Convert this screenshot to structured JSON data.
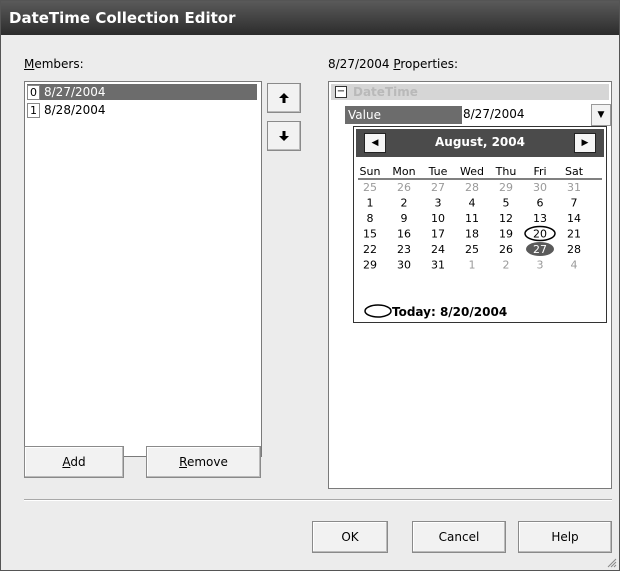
{
  "window": {
    "title": "DateTime Collection Editor"
  },
  "members": {
    "label_prefix": "",
    "label_accel": "M",
    "label_rest": "embers:",
    "items": [
      {
        "index": "0",
        "value": "8/27/2004",
        "selected": true
      },
      {
        "index": "1",
        "value": "8/28/2004",
        "selected": false
      }
    ],
    "move_up_icon": "arrow-up-icon",
    "move_down_icon": "arrow-down-icon",
    "add": {
      "accel": "A",
      "rest": "dd"
    },
    "remove": {
      "accel": "R",
      "rest": "emove"
    }
  },
  "properties": {
    "label_prefix": "8/27/2004 ",
    "label_accel": "P",
    "label_rest": "roperties:",
    "category": "DateTime",
    "category_expander": "⊟",
    "row_name": "Value",
    "row_value": "8/27/2004"
  },
  "calendar": {
    "month_title": "August, 2004",
    "day_names": [
      "Sun",
      "Mon",
      "Tue",
      "Wed",
      "Thu",
      "Fri",
      "Sat"
    ],
    "weeks": [
      [
        "25",
        "26",
        "27",
        "28",
        "29",
        "30",
        "31"
      ],
      [
        "1",
        "2",
        "3",
        "4",
        "5",
        "6",
        "7"
      ],
      [
        "8",
        "9",
        "10",
        "11",
        "12",
        "13",
        "14"
      ],
      [
        "15",
        "16",
        "17",
        "18",
        "19",
        "20",
        "21"
      ],
      [
        "22",
        "23",
        "24",
        "25",
        "26",
        "27",
        "28"
      ],
      [
        "29",
        "30",
        "31",
        "1",
        "2",
        "3",
        "4"
      ]
    ],
    "today_label": "Today: 8/20/2004",
    "colors": {
      "header_bg": "#4b4b4b",
      "other_month": "#9a9a9a",
      "selected_fill": "#5a5a5a"
    }
  },
  "buttons": {
    "ok": "OK",
    "cancel": "Cancel",
    "help": "Help"
  }
}
